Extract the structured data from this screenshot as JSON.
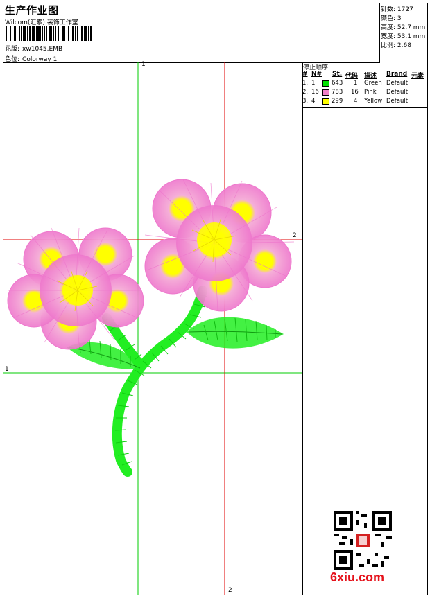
{
  "header": {
    "title": "生产作业图",
    "company": "Wilcom(汇索) 装饰工作室",
    "design_label": "花版:",
    "design_value": "xw1045.EMB",
    "colorway_label": "色位:",
    "colorway_value": "Colorway 1"
  },
  "stats": {
    "stitches": "针数: 1727",
    "colors": "颜色: 3",
    "height": "高度: 52.7 mm",
    "width": "宽度: 53.1 mm",
    "ratio": "比例: 2.68"
  },
  "stop_sequence": {
    "title": "停止顺序:",
    "columns": [
      "#",
      "N#",
      "St.",
      "代码",
      "描述",
      "Brand",
      "元素"
    ],
    "rows": [
      {
        "idx": "1.",
        "n": "1",
        "st": "643",
        "code": "1",
        "desc": "Green",
        "brand": "Default",
        "color": "#00e000"
      },
      {
        "idx": "2.",
        "n": "16",
        "st": "783",
        "code": "16",
        "desc": "Pink",
        "brand": "Default",
        "color": "#f080c8"
      },
      {
        "idx": "3.",
        "n": "4",
        "st": "299",
        "code": "4",
        "desc": "Yellow",
        "brand": "Default",
        "color": "#ffff00"
      }
    ]
  },
  "guides": {
    "green_v": "1",
    "red_h": "2",
    "green_h": "1",
    "red_v": "2"
  },
  "watermark": "6xiu.com",
  "colors": {
    "green": "#22ee22",
    "pink": "#ee77cc",
    "yellow": "#ffff00",
    "guide_red": "#e00000",
    "guide_green": "#00cc00"
  }
}
